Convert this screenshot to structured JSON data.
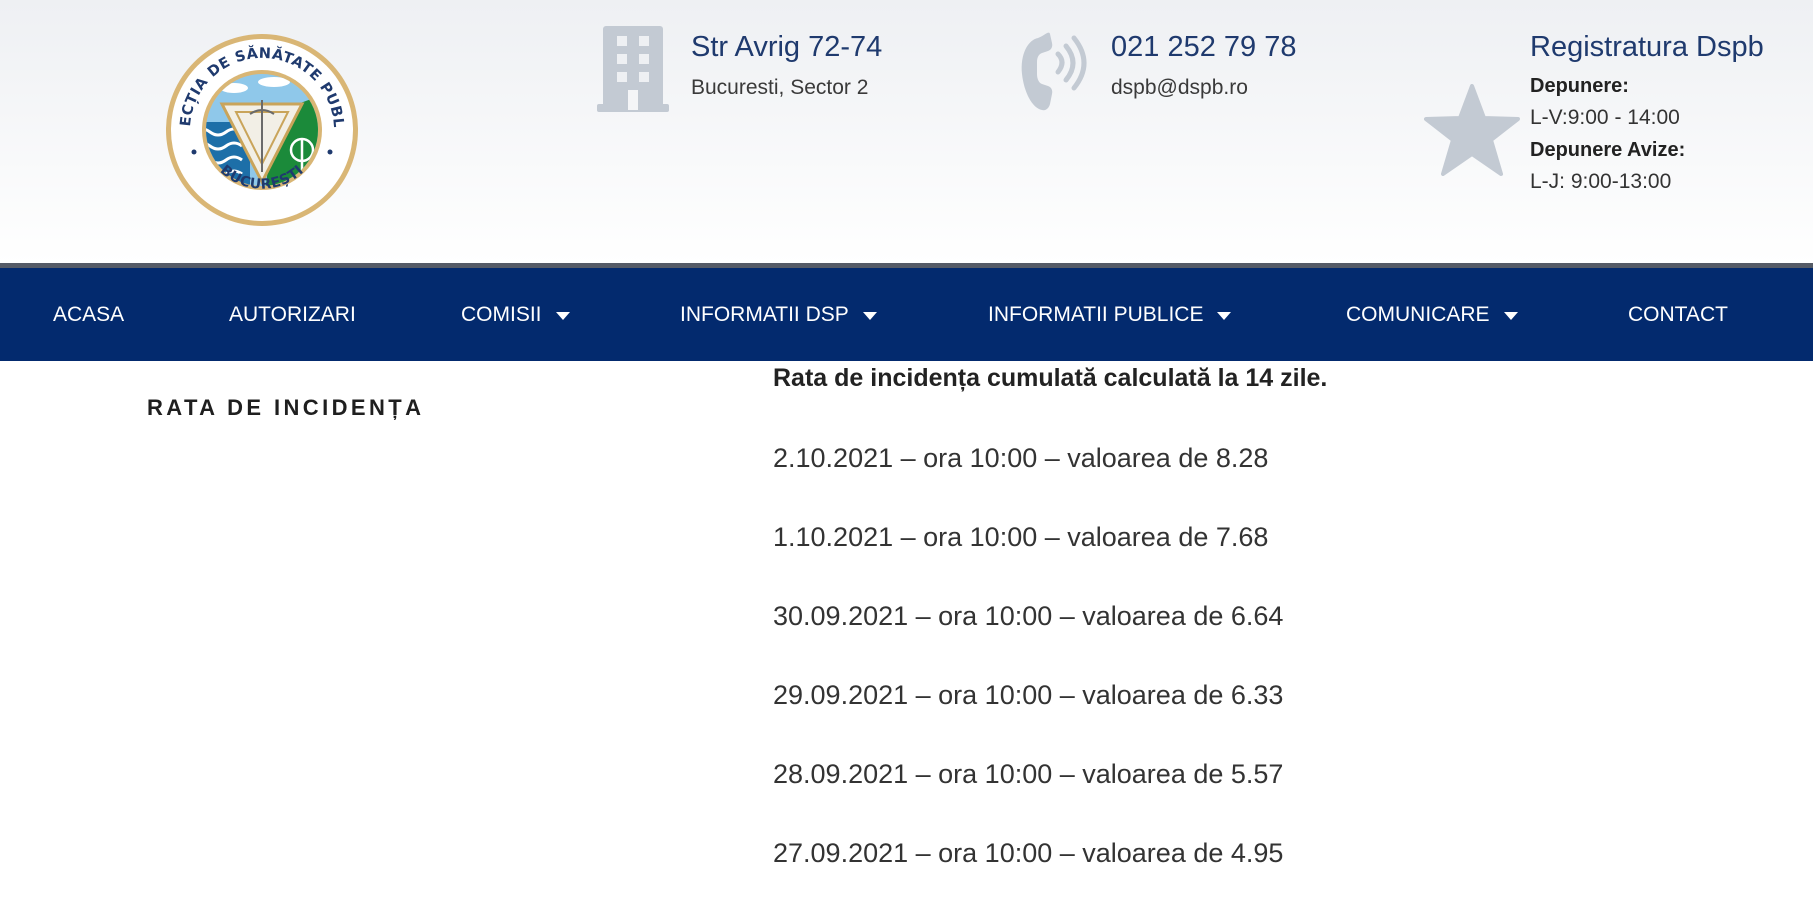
{
  "header": {
    "logo": {
      "ring_text_top": "DIRECȚIA DE SĂNĂTATE PUBLICĂ",
      "ring_text_bottom": "BUCUREȘTI",
      "colors": {
        "ring": "#d9b675",
        "water": "#1d6fa8",
        "land": "#1b8a3a",
        "sky": "#8fc8ea"
      }
    },
    "address": {
      "icon": "building-icon",
      "title": "Str Avrig 72-74",
      "sub": "Bucuresti, Sector 2"
    },
    "phone": {
      "icon": "phone-icon",
      "title": "021 252 79 78",
      "sub": "dspb@dspb.ro"
    },
    "registry": {
      "icon": "star-icon",
      "title": "Registratura Dspb",
      "line1_label": "Depunere:",
      "line1_value": "L-V:9:00 - 14:00",
      "line2_label": "Depunere Avize:",
      "line2_value": "L-J: 9:00-13:00"
    }
  },
  "nav": {
    "items": [
      {
        "label": "ACASA",
        "dropdown": false
      },
      {
        "label": "AUTORIZARI",
        "dropdown": false
      },
      {
        "label": "COMISII",
        "dropdown": true
      },
      {
        "label": "INFORMATII DSP",
        "dropdown": true
      },
      {
        "label": "INFORMATII PUBLICE",
        "dropdown": true
      },
      {
        "label": "COMUNICARE",
        "dropdown": true
      },
      {
        "label": "CONTACT",
        "dropdown": false
      }
    ],
    "background": "#032a6e"
  },
  "content": {
    "side_title": "RATA DE INCIDENȚA",
    "heading": "Rata de incidența cumulată calculată la 14 zile.",
    "entries": [
      "2.10.2021 – ora 10:00 – valoarea de 8.28",
      "1.10.2021 – ora 10:00 – valoarea de 7.68",
      "30.09.2021 – ora 10:00 – valoarea de 6.64",
      "29.09.2021 – ora 10:00 – valoarea de 6.33",
      "28.09.2021 – ora 10:00 – valoarea de 5.57",
      "27.09.2021 – ora 10:00 – valoarea de 4.95"
    ]
  }
}
